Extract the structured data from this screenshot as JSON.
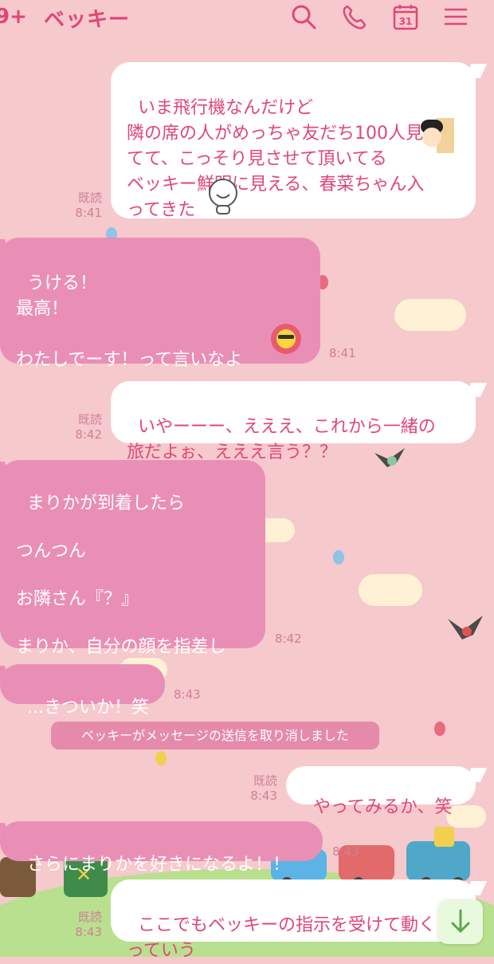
{
  "header": {
    "back_count": "9+",
    "title": "ベッキー",
    "calendar_day": "31"
  },
  "messages": [
    {
      "side": "out",
      "text": "いま飛行機なんだけど\n隣の席の人がめっちゃ友だち100人見\nてて、こっそり見させて頂いてる\nベッキー鮮明に見える、春菜ちゃん入\nってきた",
      "read": "既読",
      "time": "8:41"
    },
    {
      "side": "in",
      "text": "うける！\n最高！\n\nわたしでーす！って言いなよ",
      "time": "8:41"
    },
    {
      "side": "out",
      "text": "いやーーー、えええ、これから一緒の\n旅だよぉ、えええ言う？？",
      "read": "既読",
      "time": "8:42"
    },
    {
      "side": "in",
      "text": "まりかが到着したら\n\nつんつん\n\nお隣さん『？』\n\nまりか、自分の顔を指差し",
      "time": "8:42"
    },
    {
      "side": "in",
      "text": "...きついか！笑",
      "time": "8:43"
    },
    {
      "side": "out",
      "text": "やってみるか、笑",
      "read": "既読",
      "time": "8:43"
    },
    {
      "side": "in",
      "text": "さらにまりかを好きになるよ！！",
      "time": "8:43"
    },
    {
      "side": "out",
      "text": "ここでもベッキーの指示を受けて動く\nっていう",
      "read": "既読",
      "time": "8:43"
    }
  ],
  "system_notice": "ベッキーがメッセージの送信を取り消しました",
  "icons": {
    "search": "search-icon",
    "phone": "phone-icon",
    "calendar": "calendar-icon",
    "menu": "menu-icon",
    "scroll_down": "arrow-down-icon"
  },
  "colors": {
    "accent": "#e0467a",
    "incoming_bubble": "#e98fb5",
    "outgoing_bubble": "#ffffff",
    "background": "#f6c9cc"
  }
}
